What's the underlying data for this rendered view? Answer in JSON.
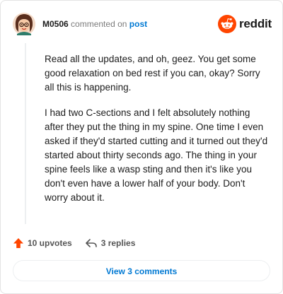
{
  "comment": {
    "username": "M0506",
    "action_text": "commented on",
    "post_link": "post",
    "paragraphs": [
      "Read all the updates, and oh, geez. You get some good relaxation on bed rest if you can, okay? Sorry all this is happening.",
      "I had two C-sections and I felt absolutely nothing after they put the thing in my spine. One time I even asked if they'd started cutting and it turned out they'd started about thirty seconds ago. The thing in your spine feels like a wasp sting and then it's like you don't even have a lower half of your body. Don't worry about it."
    ]
  },
  "brand": {
    "name": "reddit",
    "icon": "reddit-logo-icon",
    "color": "#ff4500"
  },
  "actions": {
    "upvotes_label": "10 upvotes",
    "replies_label": "3 replies",
    "upvote_icon": "upvote-arrow-icon",
    "reply_icon": "reply-arrow-icon",
    "upvote_color": "#ff4500"
  },
  "footer": {
    "view_comments_label": "View 3 comments",
    "link_color": "#0079d3"
  },
  "avatar": {
    "icon": "user-avatar-icon"
  }
}
